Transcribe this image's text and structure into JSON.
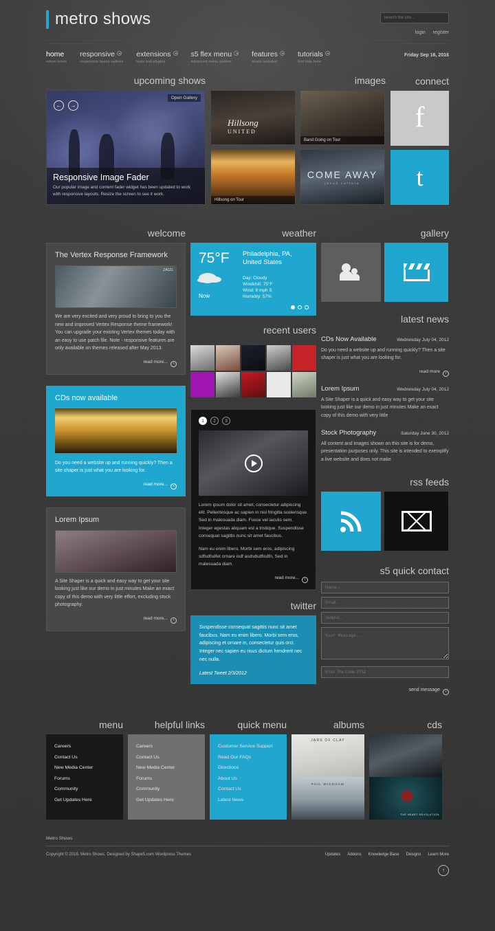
{
  "header": {
    "logo": "metro shows",
    "search_placeholder": "Search the site...",
    "login": "login",
    "register": "register",
    "date": "Friday Sep 16, 2016"
  },
  "nav": [
    {
      "label": "home",
      "desc": "return home",
      "caret": false
    },
    {
      "label": "responsive",
      "desc": "responsive layout options",
      "caret": true
    },
    {
      "label": "extensions",
      "desc": "tools and plugins",
      "caret": true
    },
    {
      "label": "s5 flex menu",
      "desc": "advanced menu system",
      "caret": true
    },
    {
      "label": "features",
      "desc": "whats included",
      "caret": true
    },
    {
      "label": "tutorials",
      "desc": "find help here",
      "caret": true
    }
  ],
  "sections": {
    "upcoming_shows": "upcoming shows",
    "images": "images",
    "connect": "connect",
    "welcome": "welcome",
    "weather": "weather",
    "gallery": "gallery",
    "recent_users": "recent users",
    "latest_news": "latest news",
    "rss_feeds": "rss feeds",
    "twitter": "twitter",
    "quick_contact": "s5 quick contact",
    "menu": "menu",
    "helpful_links": "helpful links",
    "quick_menu": "quick menu",
    "albums": "albums",
    "cds": "cds"
  },
  "fader": {
    "open_gallery": "Open Gallery",
    "title": "Responsive Image Fader",
    "text": "Our popular image and content fader widget has been updated to work with responsive layouts. Resize the screen to see it work.",
    "prev": "←",
    "next": "→"
  },
  "tiles": {
    "hillsong_logo": "Hillsong",
    "hillsong_sub": "UNITED",
    "band_caption": "Band Going on Tour",
    "hillsong_caption": "Hillsong on Tour",
    "come_away_title": "COME AWAY",
    "come_away_sub": "jesus culture"
  },
  "connect": {
    "facebook": "f",
    "twitter": "t"
  },
  "welcome": {
    "title": "The Vertex Response Framework",
    "body": "We are very excited and very proud to bring to you the new and improved Vertex Response theme framework! You can upgrade your existing Vertex themes today with an easy to use patch file. Note - responsive features are only available on themes released after May 2013.",
    "read_more": "read more..."
  },
  "weather": {
    "temp": "75°F",
    "now": "Now",
    "location": "Philadelphia, PA, United States",
    "day": "Day: Cloudy",
    "windchill": "Windchill: 75°F",
    "wind": "Wind: 9 mph S",
    "humidity": "Humidity: 57%"
  },
  "latest_news": [
    {
      "title": "CDs Now Available",
      "date": "Wednesday July 04, 2012",
      "body": "Do you need a website up and running quickly? Then a site shaper is just what you are looking for.",
      "read_more": "read more"
    },
    {
      "title": "Lorem Ipsum",
      "date": "Wednesday July 04, 2012",
      "body": "A Site Shaper is a quick and easy way to get your site looking just like our demo in just minutes Make an exact copy of this demo with very little"
    },
    {
      "title": "Stock Photography",
      "date": "Saturday June 30, 2012",
      "body": "All content and images shown on this site is for demo, presentation purposes only. This site is intended to exemplify a live website and does not make"
    }
  ],
  "cd_panel": {
    "title": "CDs now available",
    "body": "Do you need a website up and running quickly? Then a site shaper is just what you are looking for.",
    "read_more": "read more..."
  },
  "video": {
    "numbers": [
      "1",
      "2",
      "3"
    ],
    "p1": "Lorem ipsum dolor sit amet, consectetur adipiscing elit. Pellentesque ac sapien in nisl fringilla scelerisque. Sed in malesuada diam. Fusce vel iaculis sem. Integer egestas aliquam est a tristique. Suspendisse consequat sagittis nunc sit amet faucibus.",
    "p2": "Nam eu enim libero. Morbi sem eros, adipiscing sdfsdfsdfet ornare isdf asdsdsdfisdfn, Sed in malesuada diam.",
    "read_more": "read more..."
  },
  "lorem_panel": {
    "title": "Lorem Ipsum",
    "body": "A Site Shaper is a quick and easy way to get your site looking just like our demo in just minutes Make an exact copy of this demo with very little effort, excluding stock photography.",
    "read_more": "read more..."
  },
  "twitter": {
    "body": "Suspendisse consequat sagittis nunc sit amet faucibus. Nam eu enim libero. Morbi sem eros, adipiscing et ornare in, consectetur quis orci. Integer nec sapien eu risus dictum hendrerit nec nec nulla.",
    "latest": "Latest Tweet 2/3/2012"
  },
  "contact": {
    "name": "Name...",
    "email": "Email...",
    "subject": "Subject...",
    "message": "Your Message...",
    "code": "Enter The Code 3752",
    "send": "send message"
  },
  "footer_menus": {
    "menu": [
      "Careers",
      "Contact Us",
      "New Media Center",
      "Forums",
      "Community",
      "Get Updates Here"
    ],
    "helpful_links": [
      "Careers",
      "Contact Us",
      "New Media Center",
      "Forums",
      "Community",
      "Get Updates Here"
    ],
    "quick_menu": [
      "Customer Service Support",
      "Read Our FAQs",
      "Directions",
      "About Us",
      "Contact Us",
      "Latest News"
    ]
  },
  "bottom": {
    "site_name": "Metro Shows",
    "copyright": "Copyright © 2016. Metro Shows. Designed by Shape5.com Wordpress Themes",
    "links": [
      "Updates",
      "Addons",
      "Knowledge Base",
      "Designs",
      "Learn More"
    ],
    "to_top": "↑"
  },
  "colors": {
    "accent": "#1fa7d0",
    "bg": "#3b3b3b",
    "panel": "#484848",
    "dark": "#181818"
  }
}
